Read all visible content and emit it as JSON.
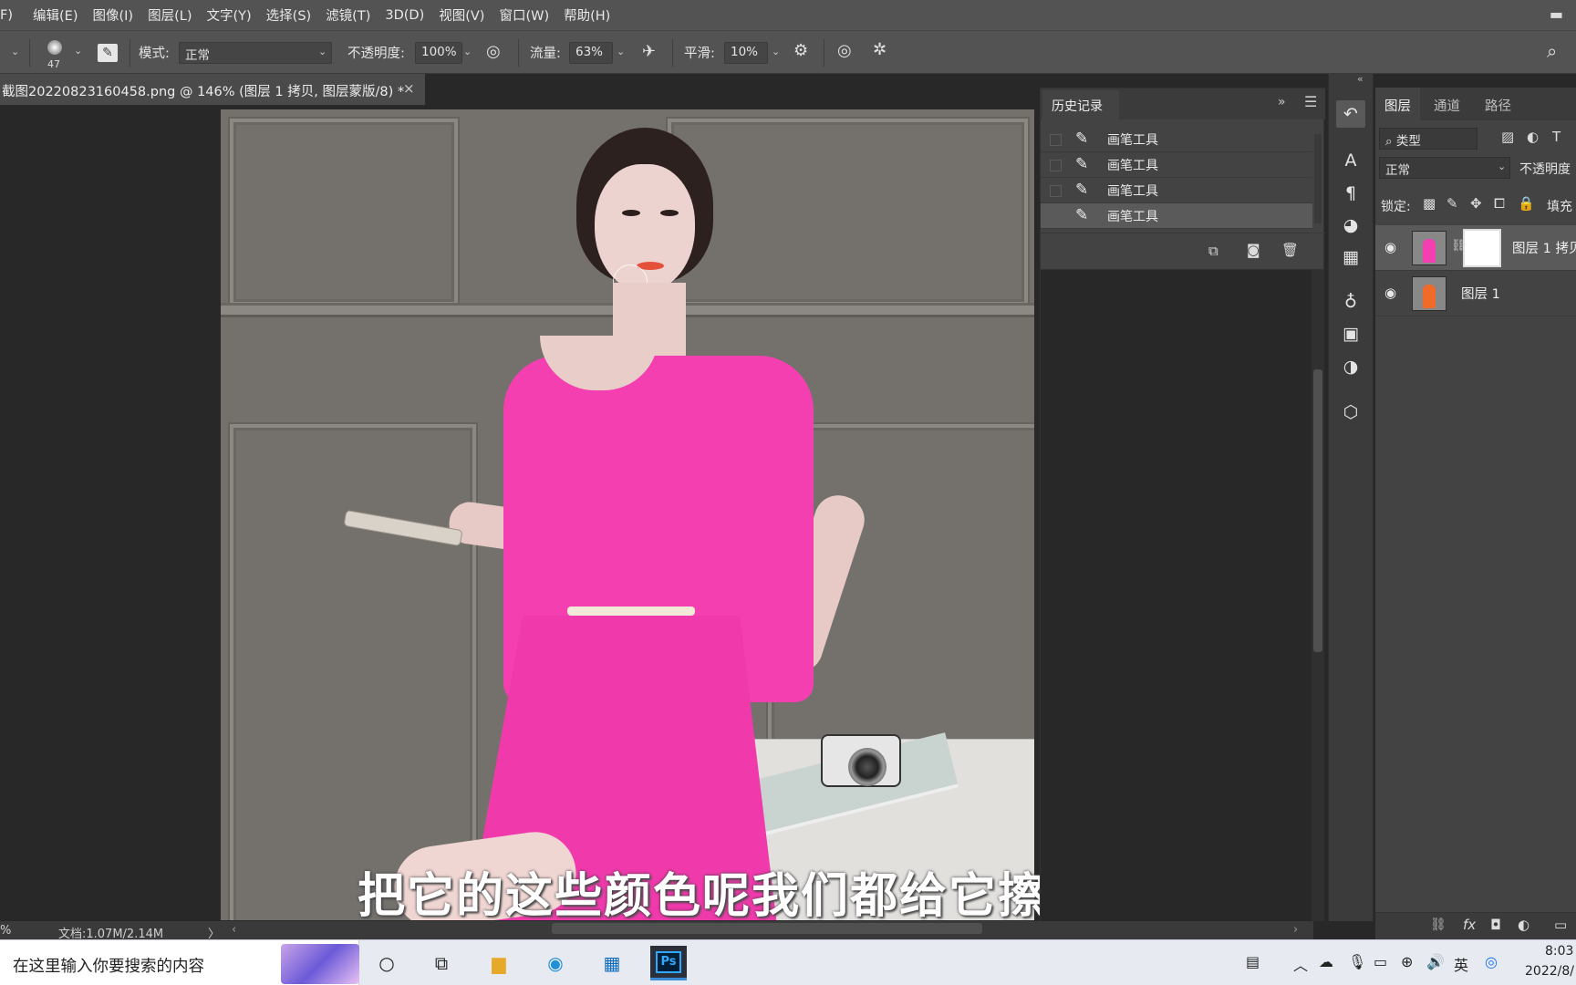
{
  "menubar": {
    "items": [
      "F)",
      "编辑(E)",
      "图像(I)",
      "图层(L)",
      "文字(Y)",
      "选择(S)",
      "滤镜(T)",
      "3D(D)",
      "视图(V)",
      "窗口(W)",
      "帮助(H)"
    ]
  },
  "options": {
    "brush_size": "47",
    "mode_label": "模式:",
    "mode_value": "正常",
    "opacity_label": "不透明度:",
    "opacity_value": "100%",
    "flow_label": "流量:",
    "flow_value": "63%",
    "smooth_label": "平滑:",
    "smooth_value": "10%"
  },
  "document": {
    "tab_title": "截图20220823160458.png @ 146% (图层 1 拷贝, 图层蒙版/8) *",
    "close": "×"
  },
  "subtitle": "把它的这些颜色呢我们都给它擦掉",
  "history": {
    "tab": "历史记录",
    "items": [
      "画笔工具",
      "画笔工具",
      "画笔工具",
      "画笔工具"
    ]
  },
  "layers": {
    "tabs": [
      "图层",
      "通道",
      "路径"
    ],
    "filter_kind": "类型",
    "blend_mode": "正常",
    "opacity_label": "不透明度",
    "lock_label": "锁定:",
    "fill_label": "填充",
    "items": [
      {
        "name": "图层 1 拷贝"
      },
      {
        "name": "图层 1"
      }
    ]
  },
  "status": {
    "zoom": "%",
    "doc_info": "文档:1.07M/2.14M",
    "arrow": "〉"
  },
  "taskbar": {
    "search_placeholder": "在这里输入你要搜索的内容",
    "time": "8:03",
    "date": "2022/8/"
  },
  "colors": {
    "dress": "#f43fb0",
    "ui_panel": "#434343",
    "menubar": "#535353"
  },
  "icons": [
    "brush-icon",
    "eye-icon",
    "search-icon",
    "gear-icon",
    "camera-icon",
    "trash-icon",
    "new-snapshot-icon"
  ]
}
